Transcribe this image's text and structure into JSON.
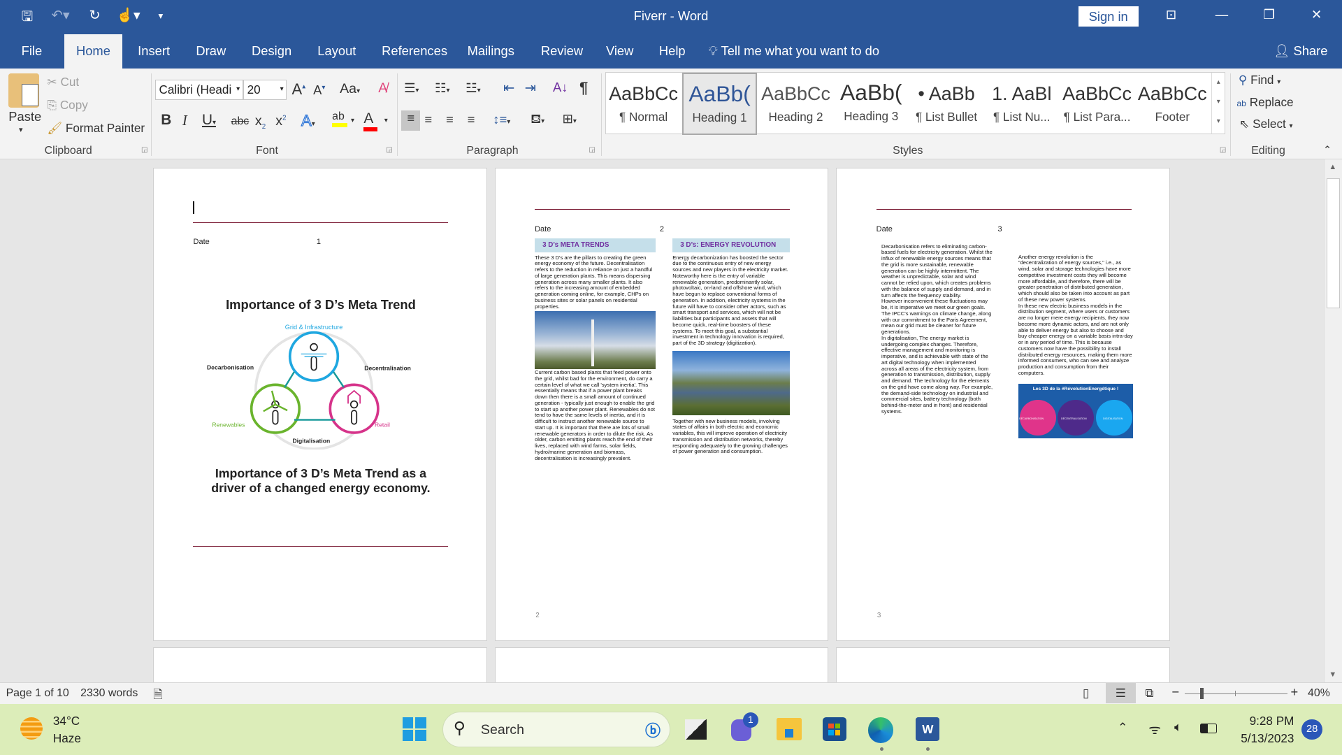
{
  "window": {
    "app_title": "Fiverr  -  Word",
    "sign_in": "Sign in",
    "share": "Share"
  },
  "quick_access": [
    "save-icon",
    "undo-icon",
    "redo-icon",
    "touch-mode-icon",
    "customize-icon"
  ],
  "tabs": [
    "File",
    "Home",
    "Insert",
    "Draw",
    "Design",
    "Layout",
    "References",
    "Mailings",
    "Review",
    "View",
    "Help"
  ],
  "tell_me": "Tell me what you want to do",
  "ribbon": {
    "clipboard": {
      "label": "Clipboard",
      "paste": "Paste",
      "cut": "Cut",
      "copy": "Copy",
      "format_painter": "Format Painter"
    },
    "font": {
      "label": "Font",
      "font_name": "Calibri (Headi",
      "font_size": "20",
      "change_case": "Aa",
      "bold": "B",
      "italic": "I",
      "underline": "U",
      "strike": "abc",
      "highlight_color": "#ffff00",
      "font_color": "#ff0000"
    },
    "paragraph": {
      "label": "Paragraph"
    },
    "styles": {
      "label": "Styles",
      "items": [
        {
          "preview": "AaBbCc",
          "name": "¶ Normal"
        },
        {
          "preview": "AaBb(",
          "name": "Heading 1",
          "selected": true
        },
        {
          "preview": "AaBbCc",
          "name": "Heading 2"
        },
        {
          "preview": "AaBb(",
          "name": "Heading 3"
        },
        {
          "preview": "• AaBb",
          "name": "¶ List Bullet"
        },
        {
          "preview": "1. AaBl",
          "name": "¶ List Nu..."
        },
        {
          "preview": "AaBbCc",
          "name": "¶ List Para..."
        },
        {
          "preview": "AaBbCc",
          "name": "Footer"
        }
      ]
    },
    "editing": {
      "label": "Editing",
      "find": "Find",
      "replace": "Replace",
      "select": "Select"
    }
  },
  "pages": [
    {
      "date": "Date",
      "number": "1",
      "title": "Importance of 3 D’s Meta Trend",
      "diagram": {
        "top": "Grid & Infrastructure",
        "left": "Decarbonisation",
        "right": "Decentralisation",
        "bottom": "Digitalisation",
        "green": "Renewables",
        "pink": "Retail"
      },
      "subtitle": "Importance of 3 D’s Meta Trend as a driver of a changed energy economy."
    },
    {
      "date": "Date",
      "number": "2",
      "footer": "2",
      "col1_head": "3 D’s META TRENDS",
      "col1_text1": "These 3 D's are the pillars to creating the green energy economy of the future. Decentralisation refers to the reduction in reliance on just a handful of large generation plants. This means dispersing generation across many smaller plants. It also refers to the increasing amount of embedded generation coming online, for example, CHPs on business sites or solar panels on residential properties.",
      "col1_text2": "Current carbon based plants that feed power onto the grid, whilst bad for the environment, do carry a certain level of what we call 'system inertia'. This essentially means that if a power plant breaks down then there is a small amount of continued generation - typically just enough to enable the grid to start up another power plant. Renewables do not tend to have the same levels of inertia, and it is difficult to instruct another renewable source to start up. It is important that there are lots of small renewable generators in order to dilute the risk. As older, carbon emitting plants reach the end of their lives, replaced with wind farms, solar fields, hydro/marine generation and biomass, decentralisation is increasingly prevalent.",
      "col2_head": "3 D’s: ENERGY REVOLUTION",
      "col2_text1": "Energy decarbonization has boosted the sector due to the continuous entry of new energy sources and new players in the electricity market. Noteworthy here is the entry of variable renewable generation, predominantly solar, photovoltaic, on-land and offshore wind, which have begun to replace conventional forms of generation. In addition, electricity systems in the future will have to consider other actors, such as smart transport and services, which will not be liabilities but participants and assets that will become quick, real-time boosters of these systems. To meet this goal, a substantial investment in technology innovation is required, part of the 3D strategy (digitization).",
      "col2_text2": "Together with new business models, involving states of affairs in both electric and economic variables, this will improve operation of electricity transmission and distribution networks, thereby responding adequately to the growing challenges of power generation and consumption."
    },
    {
      "date": "Date",
      "number": "3",
      "footer": "3",
      "col1_text": "Decarbonisation refers to eliminating carbon-based fuels for electricity generation. Whilst the influx of renewable energy sources means that the grid is more sustainable, renewable generation can be highly intermittent. The weather is unpredictable, solar and wind cannot be relied upon, which creates problems with the balance of supply and demand, and in turn affects the frequency stability.\nHowever inconvenient these fluctuations may be, it is imperative we meet our green goals. The IPCC's warnings on climate change, along with our commitment to the Paris Agreement, mean our grid must be cleaner for future generations.\nIn digitalisation, The energy market is undergoing complex changes. Therefore, effective management and monitoring is imperative, and is achievable with state of the art digital technology when implemented across all areas of the electricity system, from generation to transmission, distribution, supply and demand. The technology for the elements on the grid have come along way. For example, the demand-side technology on industrial and commercial sites, battery technology (both behind-the-meter and in front) and residential systems.",
      "col2_text": "Another energy revolution is the \"decentralization of energy sources,\" i.e., as wind, solar and storage technologies have more competitive investment costs they will become more affordable, and therefore, there will be greater penetration of distributed generation, which should also be taken into account as part of these new power systems.\nIn these new electric business models in the distribution segment, where users or customers are no longer mere energy recipients, they now become more dynamic actors, and are not only able to deliver energy but also to choose and buy cheaper energy on a variable basis intra-day or in any period of time.  This is because customers now have the possibility to install distributed energy resources, making them more informed consumers, who can see and analyze production and consumption from their computers.",
      "banner": {
        "title": "Les 3D de la #RévolutionEnergétique !",
        "c1": "DÉCARBONISATION",
        "c2": "DÉCENTRALISATION",
        "c3": "DIGITALISATION"
      }
    }
  ],
  "status": {
    "page": "Page 1 of 10",
    "words": "2330 words",
    "zoom": "40%",
    "zoom_percent": 40
  },
  "taskbar": {
    "temp": "34°C",
    "weather": "Haze",
    "search": "Search",
    "teams_badge": "1",
    "time": "9:28 PM",
    "date": "5/13/2023",
    "notifications": "28"
  },
  "colors": {
    "word_blue": "#2b579a",
    "ribbon": "#f3f3f3",
    "taskbar": "#dcedb9",
    "rule": "#7a1a33",
    "heading_purple": "#7030a0",
    "heading_bg": "#c5dfea"
  }
}
